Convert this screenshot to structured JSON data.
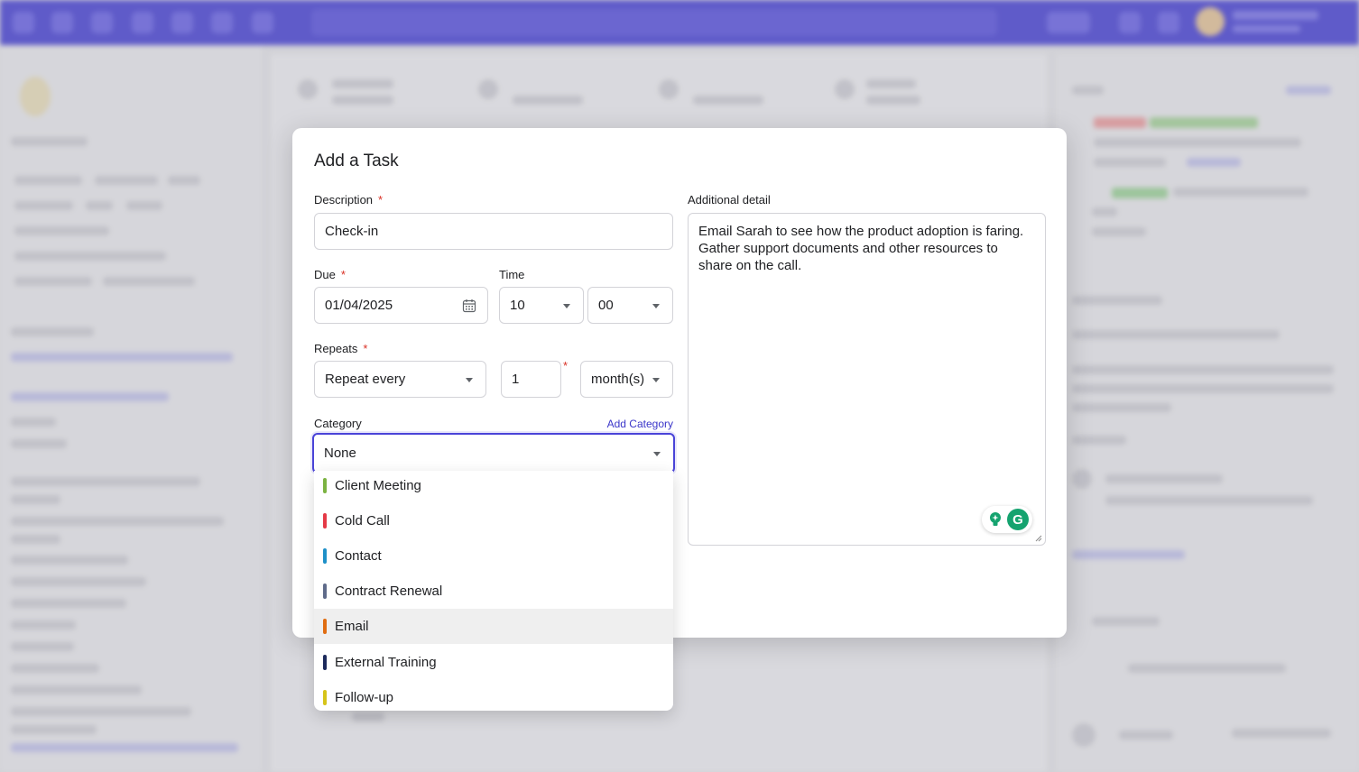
{
  "modal": {
    "title": "Add a Task",
    "description": {
      "label": "Description",
      "value": "Check-in"
    },
    "due": {
      "label": "Due",
      "value": "01/04/2025"
    },
    "time": {
      "label": "Time",
      "hour": "10",
      "minute": "00"
    },
    "repeats": {
      "label": "Repeats",
      "mode": "Repeat every",
      "count": "1",
      "unit": "month(s)"
    },
    "category": {
      "label": "Category",
      "add_label": "Add Category",
      "selected": "None"
    },
    "additional": {
      "label": "Additional detail",
      "value": "Email Sarah to see how the product adoption is faring. Gather support documents and other resources to share on the call."
    }
  },
  "category_options": [
    {
      "label": "Client Meeting",
      "color": "#7cb342"
    },
    {
      "label": "Cold Call",
      "color": "#e53946"
    },
    {
      "label": "Contact",
      "color": "#1e90c8"
    },
    {
      "label": "Contract Renewal",
      "color": "#5f6b8a"
    },
    {
      "label": "Email",
      "color": "#e06d12"
    },
    {
      "label": "External Training",
      "color": "#1c2a5c"
    },
    {
      "label": "Follow-up",
      "color": "#d6c419"
    }
  ],
  "colors": {
    "accent": "#4a44d8",
    "required": "#d93025",
    "hover": "#efefef"
  },
  "icons": {
    "date": "calendar-icon",
    "dropdown": "caret-down-icon",
    "assistant": "grammarly-icon",
    "suggestion": "lightbulb-icon"
  }
}
